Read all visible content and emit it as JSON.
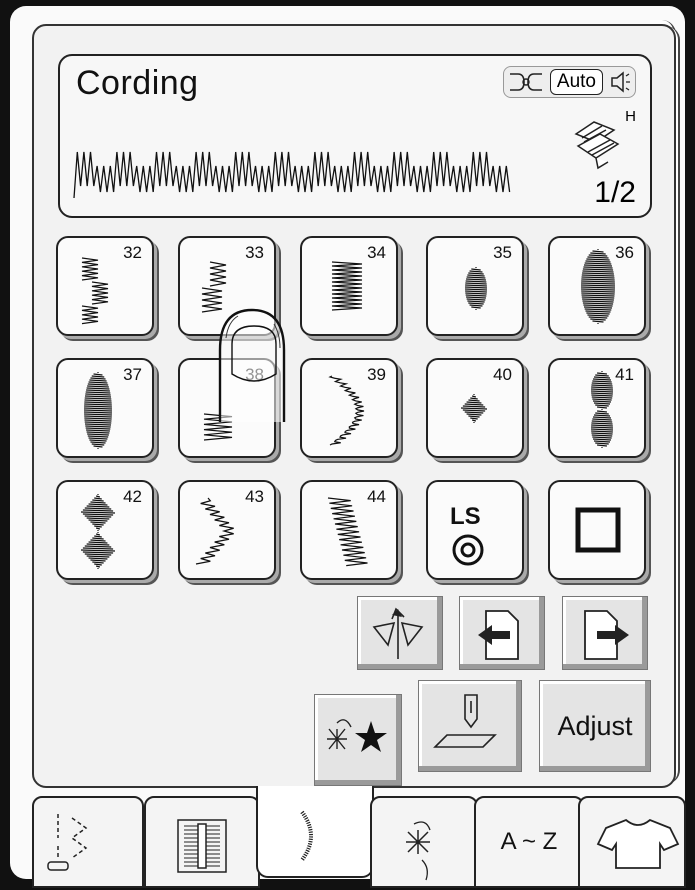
{
  "header": {
    "title": "Cording",
    "auto_label": "Auto",
    "foot_letter": "H",
    "page_indicator": "1/2",
    "icons": [
      "thread-tension-icon",
      "speaker-icon",
      "presser-foot-icon"
    ]
  },
  "stitches": [
    {
      "number": "32"
    },
    {
      "number": "33"
    },
    {
      "number": "34"
    },
    {
      "number": "35"
    },
    {
      "number": "36"
    },
    {
      "number": "37"
    },
    {
      "number": "38"
    },
    {
      "number": "39"
    },
    {
      "number": "40"
    },
    {
      "number": "41"
    },
    {
      "number": "42"
    },
    {
      "number": "43"
    },
    {
      "number": "44"
    },
    {
      "number": ""
    },
    {
      "number": ""
    }
  ],
  "ls_label": "LS",
  "function_buttons": {
    "adjust_label": "Adjust",
    "icons": [
      "mirror-image-icon",
      "page-back-icon",
      "page-forward-icon",
      "memory-star-icon",
      "needle-position-icon"
    ]
  },
  "tabs": [
    {
      "label": ""
    },
    {
      "label": ""
    },
    {
      "label": ""
    },
    {
      "label": ""
    },
    {
      "label": "A ~ Z"
    },
    {
      "label": ""
    }
  ]
}
